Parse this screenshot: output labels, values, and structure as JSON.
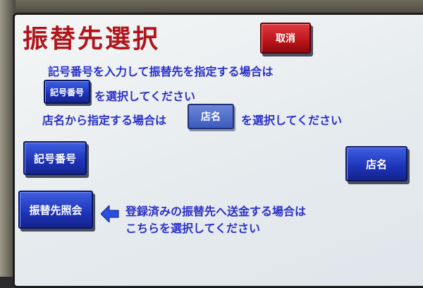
{
  "screen": {
    "title": "振替先選択",
    "cancel_label": "取消",
    "instructions": {
      "line1": "記号番号を入力して振替先を指定する場合は",
      "kigo_button_label": "記号番号",
      "line2": "を選択してください",
      "line3_prefix": "店名から指定する場合は",
      "tenmei_button_label": "店名",
      "line3_suffix": "を選択してください"
    },
    "buttons": {
      "kigo": "記号番号",
      "tenmei": "店名",
      "shokai": "振替先照会"
    },
    "registered_hint": {
      "line1": "登録済みの振替先へ送金する場合は",
      "line2": "こちらを選択してください"
    }
  },
  "colors": {
    "title": "#b0141a",
    "text": "#2a2fc8",
    "button_blue": "#1d33b8",
    "button_red": "#b71218"
  },
  "icons": {
    "pointer": "left-arrow-icon"
  }
}
